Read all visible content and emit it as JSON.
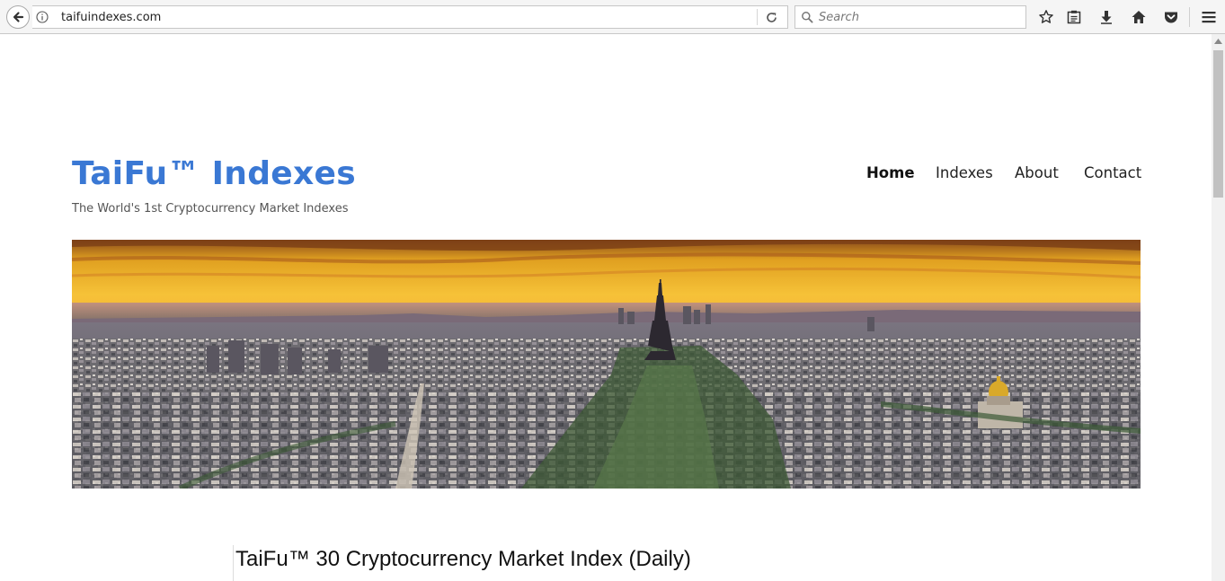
{
  "browser": {
    "url": "taifuindexes.com",
    "search_placeholder": "Search",
    "icons": [
      "back-arrow-icon",
      "info-icon",
      "reload-icon",
      "search-icon",
      "bookmark-star-icon",
      "reading-list-icon",
      "download-icon",
      "home-icon",
      "pocket-icon",
      "menu-icon"
    ]
  },
  "site": {
    "title": "TaiFu™ Indexes",
    "description": "The World's 1st Cryptocurrency Market Indexes",
    "brand_color": "#3a78d4"
  },
  "nav": {
    "items": [
      {
        "label": "Home",
        "active": true
      },
      {
        "label": "Indexes",
        "active": false
      },
      {
        "label": "About",
        "active": false
      },
      {
        "label": "Contact",
        "active": false
      }
    ]
  },
  "content": {
    "entry_title": "TaiFu™ 30 Cryptocurrency Market Index (Daily)"
  }
}
